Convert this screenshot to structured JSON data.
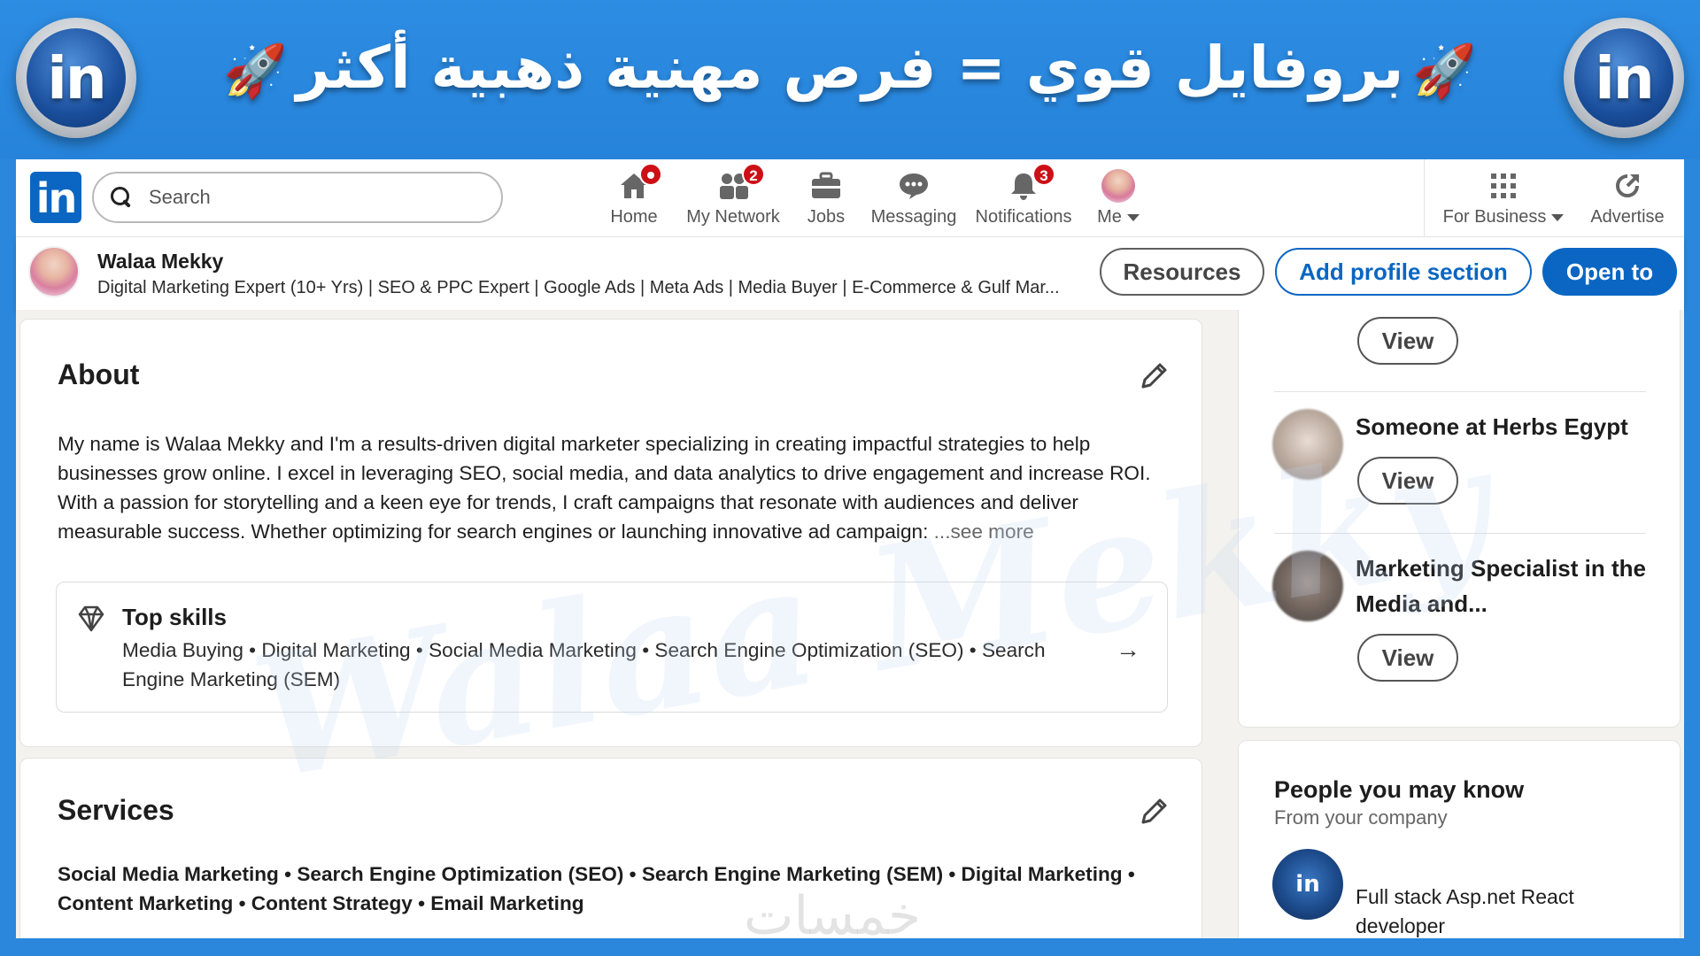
{
  "banner": {
    "title": "بروفايل قوي = فرص مهنية ذهبية أكثر",
    "logo_text": "in"
  },
  "nav": {
    "logo_text": "in",
    "search_placeholder": "Search",
    "items": [
      {
        "label": "Home",
        "icon": "home-icon",
        "badge": ""
      },
      {
        "label": "My Network",
        "icon": "people-icon",
        "badge": "2"
      },
      {
        "label": "Jobs",
        "icon": "briefcase-icon",
        "badge": ""
      },
      {
        "label": "Messaging",
        "icon": "chat-icon",
        "badge": ""
      },
      {
        "label": "Notifications",
        "icon": "bell-icon",
        "badge": "3"
      },
      {
        "label": "Me",
        "icon": "avatar",
        "badge": ""
      },
      {
        "label": "For Business",
        "icon": "grid-icon",
        "badge": ""
      },
      {
        "label": "Advertise",
        "icon": "advertise-icon",
        "badge": ""
      }
    ]
  },
  "profile_bar": {
    "name": "Walaa Mekky",
    "headline": "Digital Marketing Expert (10+ Yrs) | SEO & PPC Expert | Google Ads | Meta Ads | Media Buyer | E-Commerce & Gulf Mar...",
    "resources_label": "Resources",
    "add_section_label": "Add profile section",
    "open_to_label": "Open to"
  },
  "about": {
    "title": "About",
    "text": "My name is Walaa Mekky and I'm a results-driven digital marketer specializing in creating impactful strategies to help businesses grow online. I excel in leveraging SEO, social media, and data analytics to drive engagement and increase ROI. With a passion for storytelling and a keen eye for trends, I craft campaigns that resonate with audiences and deliver measurable success. Whether optimizing for search engines or launching innovative ad campaign:",
    "see_more": "...see more",
    "top_skills_title": "Top skills",
    "top_skills": "Media Buying • Digital Marketing • Social Media Marketing • Search Engine Optimization (SEO) • Search Engine Marketing (SEM)"
  },
  "services": {
    "title": "Services",
    "list": "Social Media Marketing • Search Engine Optimization (SEO) • Search Engine Marketing (SEM) • Digital Marketing • Content Marketing • Content Strategy • Email Marketing"
  },
  "right_panel": {
    "viewers": [
      {
        "name": "",
        "view_label": "View"
      },
      {
        "name": "Someone at Herbs Egypt",
        "view_label": "View"
      },
      {
        "name": "Marketing Specialist in the Media and...",
        "view_label": "View"
      }
    ],
    "pymk_title": "People you may know",
    "pymk_subtitle": "From your company",
    "pymk_person": {
      "name": "Full stack Asp.net React developer",
      "avatar_text": "in"
    }
  },
  "watermark": "Walaa Mekky",
  "footer_watermark": "خمسات",
  "colors": {
    "banner_blue": "#2a87dc",
    "linkedin_blue": "#0a66c2",
    "badge_red": "#cc1016"
  }
}
